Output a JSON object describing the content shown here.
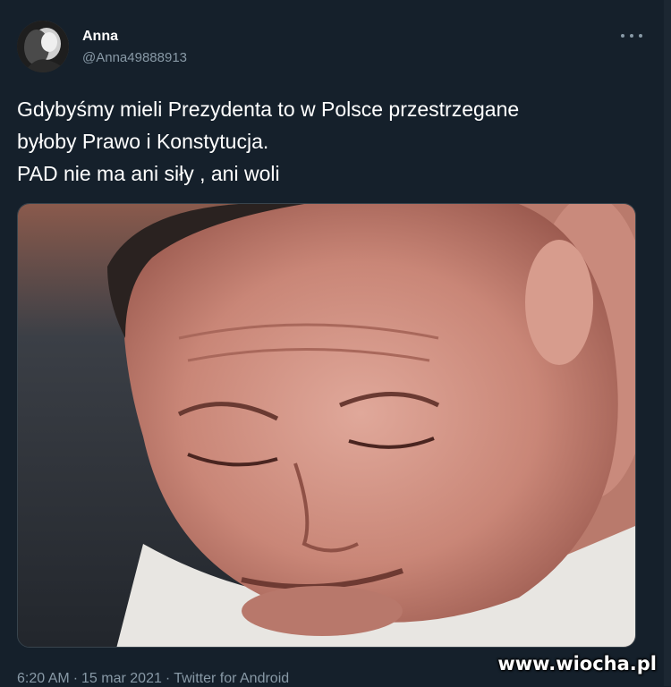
{
  "tweet": {
    "display_name": "Anna",
    "handle": "@Anna49888913",
    "text_lines": [
      "Gdybyśmy mieli Prezydenta to w Polsce przestrzegane",
      "byłoby Prawo i Konstytucja.",
      "PAD nie ma ani siły , ani woli"
    ],
    "time": "6:20 AM",
    "separator": "·",
    "date": "15 mar 2021",
    "source": "Twitter for Android",
    "more_icon": "more-horizontal-icon"
  },
  "watermark": "www.wiocha.pl",
  "colors": {
    "background": "#15202b",
    "text": "#ffffff",
    "secondary_text": "#8899a6",
    "border": "#38444d"
  }
}
